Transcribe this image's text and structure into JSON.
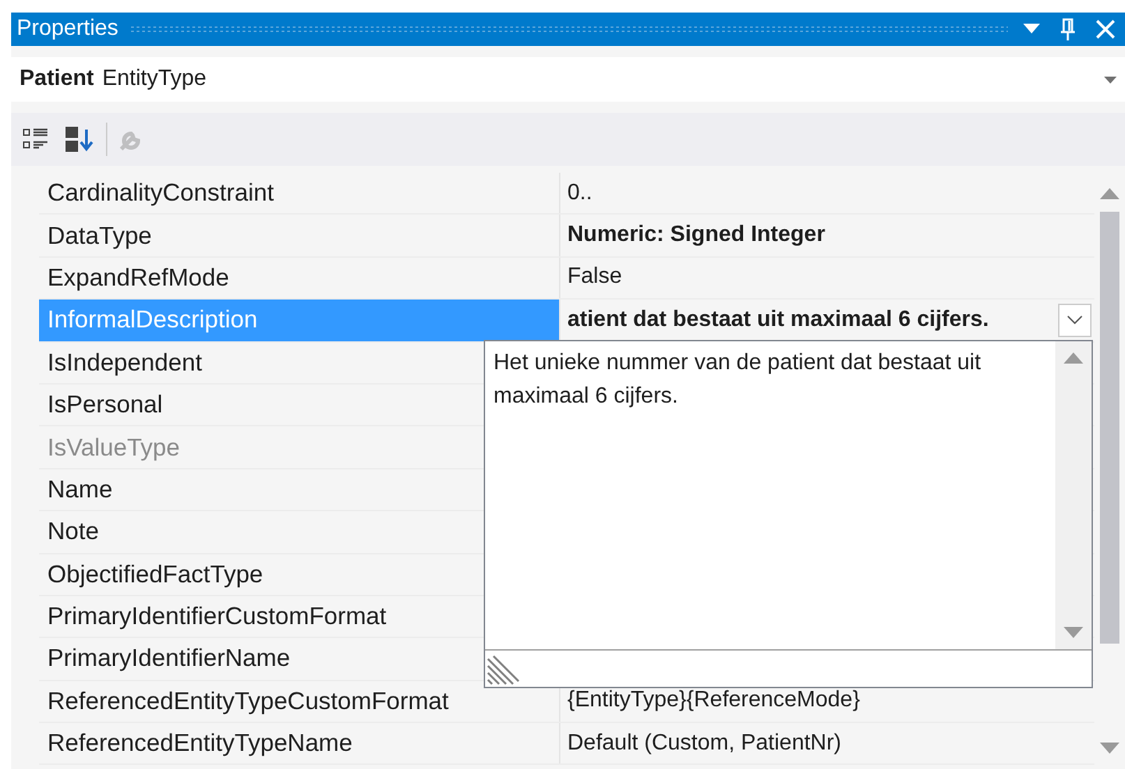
{
  "window": {
    "title": "Properties"
  },
  "object_selector": {
    "name": "Patient",
    "type": "EntityType"
  },
  "toolbar": [
    {
      "kind": "categorized",
      "disabled": false
    },
    {
      "kind": "alphabetical",
      "disabled": false
    },
    {
      "kind": "separator"
    },
    {
      "kind": "property_pages",
      "disabled": true
    }
  ],
  "properties": [
    {
      "name": "CardinalityConstraint",
      "value": "0..",
      "modified": false,
      "disabled": false,
      "selected": false
    },
    {
      "name": "DataType",
      "value": "Numeric: Signed Integer",
      "modified": true,
      "disabled": false,
      "selected": false
    },
    {
      "name": "ExpandRefMode",
      "value": "False",
      "modified": false,
      "disabled": false,
      "selected": false
    },
    {
      "name": "InformalDescription",
      "value": "atient dat bestaat uit maximaal 6 cijfers.",
      "modified": true,
      "disabled": false,
      "selected": true
    },
    {
      "name": "IsIndependent",
      "disabled": false,
      "selected": false
    },
    {
      "name": "IsPersonal",
      "disabled": false,
      "selected": false
    },
    {
      "name": "IsValueType",
      "disabled": true,
      "selected": false
    },
    {
      "name": "Name",
      "disabled": false,
      "selected": false
    },
    {
      "name": "Note",
      "disabled": false,
      "selected": false
    },
    {
      "name": "ObjectifiedFactType",
      "disabled": false,
      "selected": false
    },
    {
      "name": "PrimaryIdentifierCustomFormat",
      "disabled": false,
      "selected": false
    },
    {
      "name": "PrimaryIdentifierName",
      "disabled": false,
      "selected": false
    },
    {
      "name": "ReferencedEntityTypeCustomFormat",
      "value": "{EntityType}{ReferenceMode}",
      "modified": false,
      "disabled": false,
      "selected": false
    },
    {
      "name": "ReferencedEntityTypeName",
      "value": "Default (Custom, PatientNr)",
      "modified": false,
      "disabled": false,
      "selected": false
    }
  ],
  "editor_popup": {
    "value": "Het unieke nummer van de patient dat bestaat uit maximaal 6 cijfers."
  }
}
